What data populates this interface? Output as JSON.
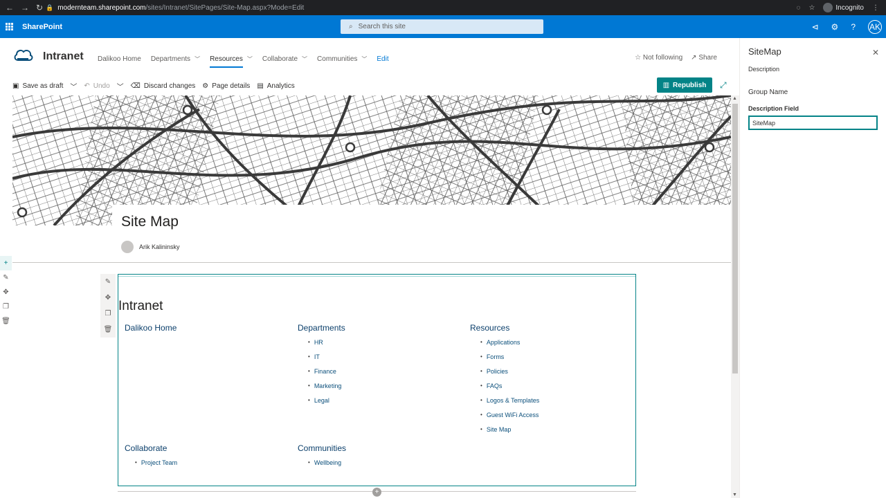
{
  "browser": {
    "url_host": "modernteam.sharepoint.com",
    "url_path": "/sites/Intranet/SitePages/Site-Map.aspx?Mode=Edit",
    "incognito_label": "Incognito"
  },
  "suitebar": {
    "app_name": "SharePoint",
    "search_placeholder": "Search this site",
    "avatar_initials": "AK"
  },
  "site": {
    "title": "Intranet",
    "nav": [
      {
        "label": "Dalikoo Home",
        "dropdown": false
      },
      {
        "label": "Departments",
        "dropdown": true
      },
      {
        "label": "Resources",
        "dropdown": true
      },
      {
        "label": "Collaborate",
        "dropdown": true
      },
      {
        "label": "Communities",
        "dropdown": true
      },
      {
        "label": "Edit",
        "dropdown": false
      }
    ],
    "follow_label": "Not following",
    "share_label": "Share"
  },
  "commandbar": {
    "save_draft": "Save as draft",
    "undo": "Undo",
    "discard": "Discard changes",
    "page_details": "Page details",
    "analytics": "Analytics",
    "republish": "Republish"
  },
  "page": {
    "title": "Site Map",
    "author": "Arik Kalininsky"
  },
  "sitemap": {
    "heading": "Intranet",
    "columns": [
      {
        "title": "Dalikoo Home",
        "items": []
      },
      {
        "title": "Departments",
        "items": [
          "HR",
          "IT",
          "Finance",
          "Marketing",
          "Legal"
        ]
      },
      {
        "title": "Resources",
        "items": [
          "Applications",
          "Forms",
          "Policies",
          "FAQs",
          "Logos & Templates",
          "Guest WiFi Access",
          "Site Map"
        ]
      },
      {
        "title": "Collaborate",
        "items": [
          "Project Team"
        ]
      },
      {
        "title": "Communities",
        "items": [
          "Wellbeing"
        ]
      }
    ]
  },
  "property_pane": {
    "title": "SiteMap",
    "description": "Description",
    "group_name": "Group Name",
    "field_label": "Description Field",
    "field_value": "SiteMap"
  },
  "colors": {
    "suite_blue": "#0078d4",
    "accent_teal": "#038387",
    "link_blue": "#0b4f7b"
  }
}
